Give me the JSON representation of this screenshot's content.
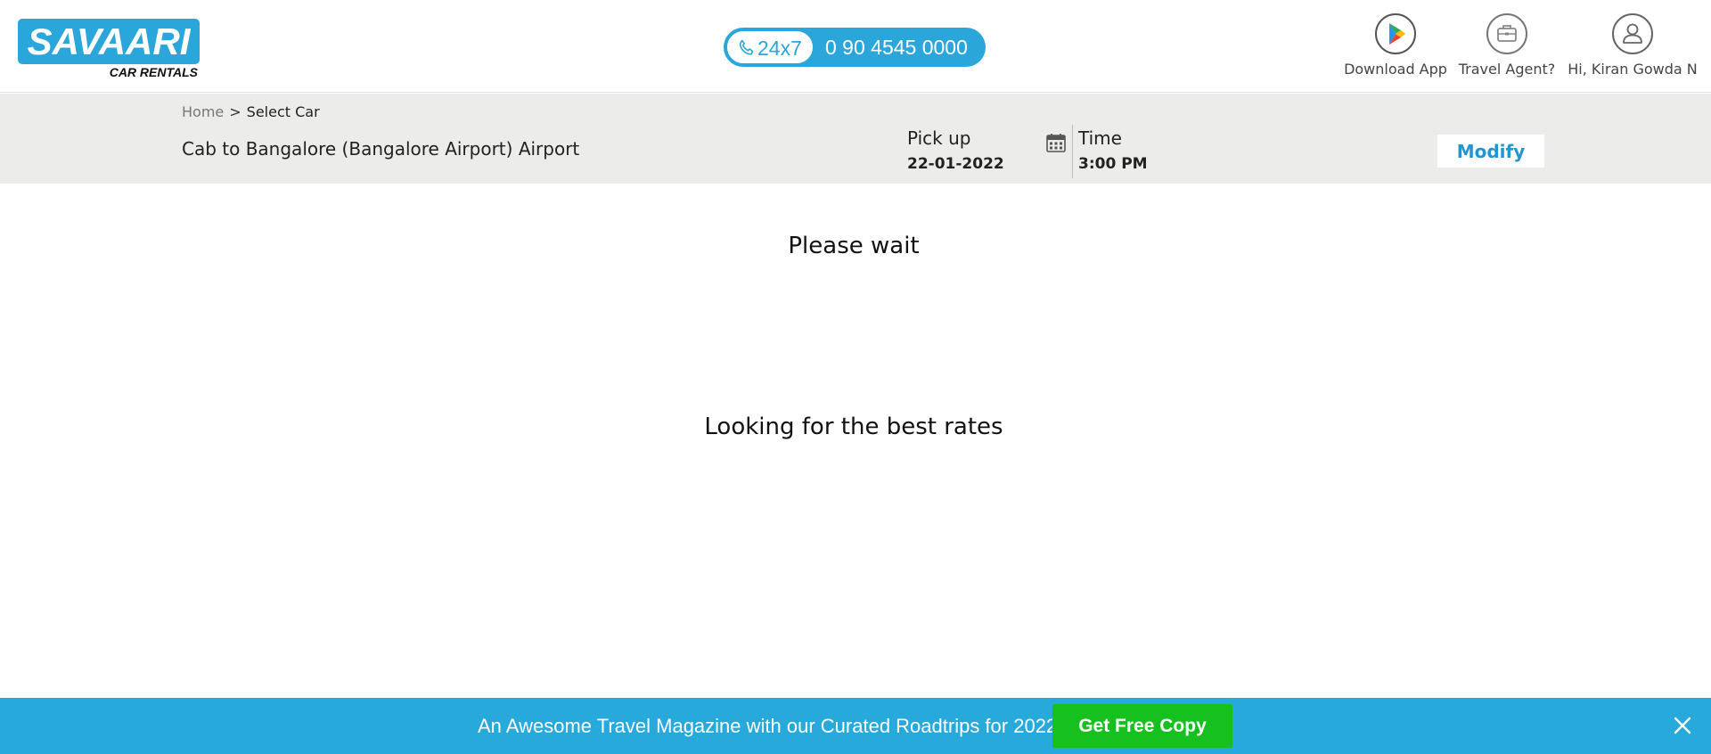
{
  "header": {
    "logo_text": "SAVAARI",
    "logo_sub": "CAR RENTALS",
    "phone_badge": "24x7",
    "phone_number": "0 90 4545 0000",
    "nav": {
      "download_app": "Download App",
      "travel_agent": "Travel Agent?",
      "user_greeting": "Hi, Kiran Gowda N"
    }
  },
  "breadcrumb": {
    "home": "Home",
    "separator": ">",
    "current": "Select Car"
  },
  "trip": {
    "route_title": "Cab to Bangalore (Bangalore Airport) Airport",
    "pickup_label": "Pick up",
    "pickup_date": "22-01-2022",
    "time_label": "Time",
    "time_value": "3:00 PM",
    "modify_label": "Modify"
  },
  "main": {
    "wait_text": "Please wait",
    "rates_text": "Looking for the best rates"
  },
  "banner": {
    "text": "An Awesome Travel Magazine with our Curated Roadtrips for 2022",
    "button_label": "Get Free Copy"
  },
  "colors": {
    "brand_blue": "#2aa6da",
    "band_gray": "#ececea",
    "cta_green": "#16c11f",
    "link_blue": "#2196d3"
  },
  "icons": [
    "phone-icon",
    "google-play-icon",
    "briefcase-icon",
    "user-icon",
    "calendar-icon",
    "close-icon"
  ]
}
